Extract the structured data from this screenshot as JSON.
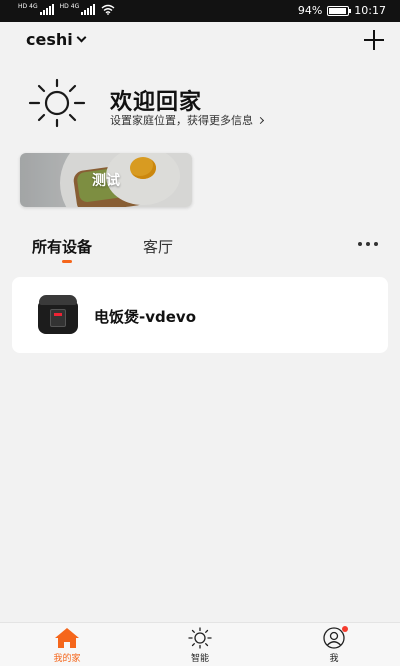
{
  "status_bar": {
    "sim1_label": "HD",
    "sim1_net": "4G",
    "sim2_label": "HD",
    "sim2_net": "4G",
    "battery_percent": "94%",
    "battery_level": 0.94,
    "time": "10:17",
    "icons": [
      "signal-icon",
      "wifi-icon",
      "battery-icon"
    ]
  },
  "header": {
    "home_name": "ceshi",
    "home_dropdown_icon": "chevron-down-icon",
    "add_icon": "plus-icon"
  },
  "welcome": {
    "icon": "sun-icon",
    "title": "欢迎回家",
    "subtitle": "设置家庭位置，获得更多信息"
  },
  "scenes": [
    {
      "label": "测试"
    }
  ],
  "tabs": [
    {
      "label": "所有设备",
      "active": true
    },
    {
      "label": "客厅",
      "active": false
    }
  ],
  "devices": [
    {
      "name": "电饭煲-vdevo",
      "icon": "rice-cooker-icon"
    }
  ],
  "bottom_nav": [
    {
      "label": "我的家",
      "icon": "home-icon",
      "active": true,
      "color": "#f5661b"
    },
    {
      "label": "智能",
      "icon": "sun-icon",
      "active": false
    },
    {
      "label": "我",
      "icon": "user-icon",
      "active": false,
      "badge": true
    }
  ],
  "colors": {
    "accent": "#f5661b",
    "background": "#f2f2f2",
    "badge": "#f53c2e"
  }
}
